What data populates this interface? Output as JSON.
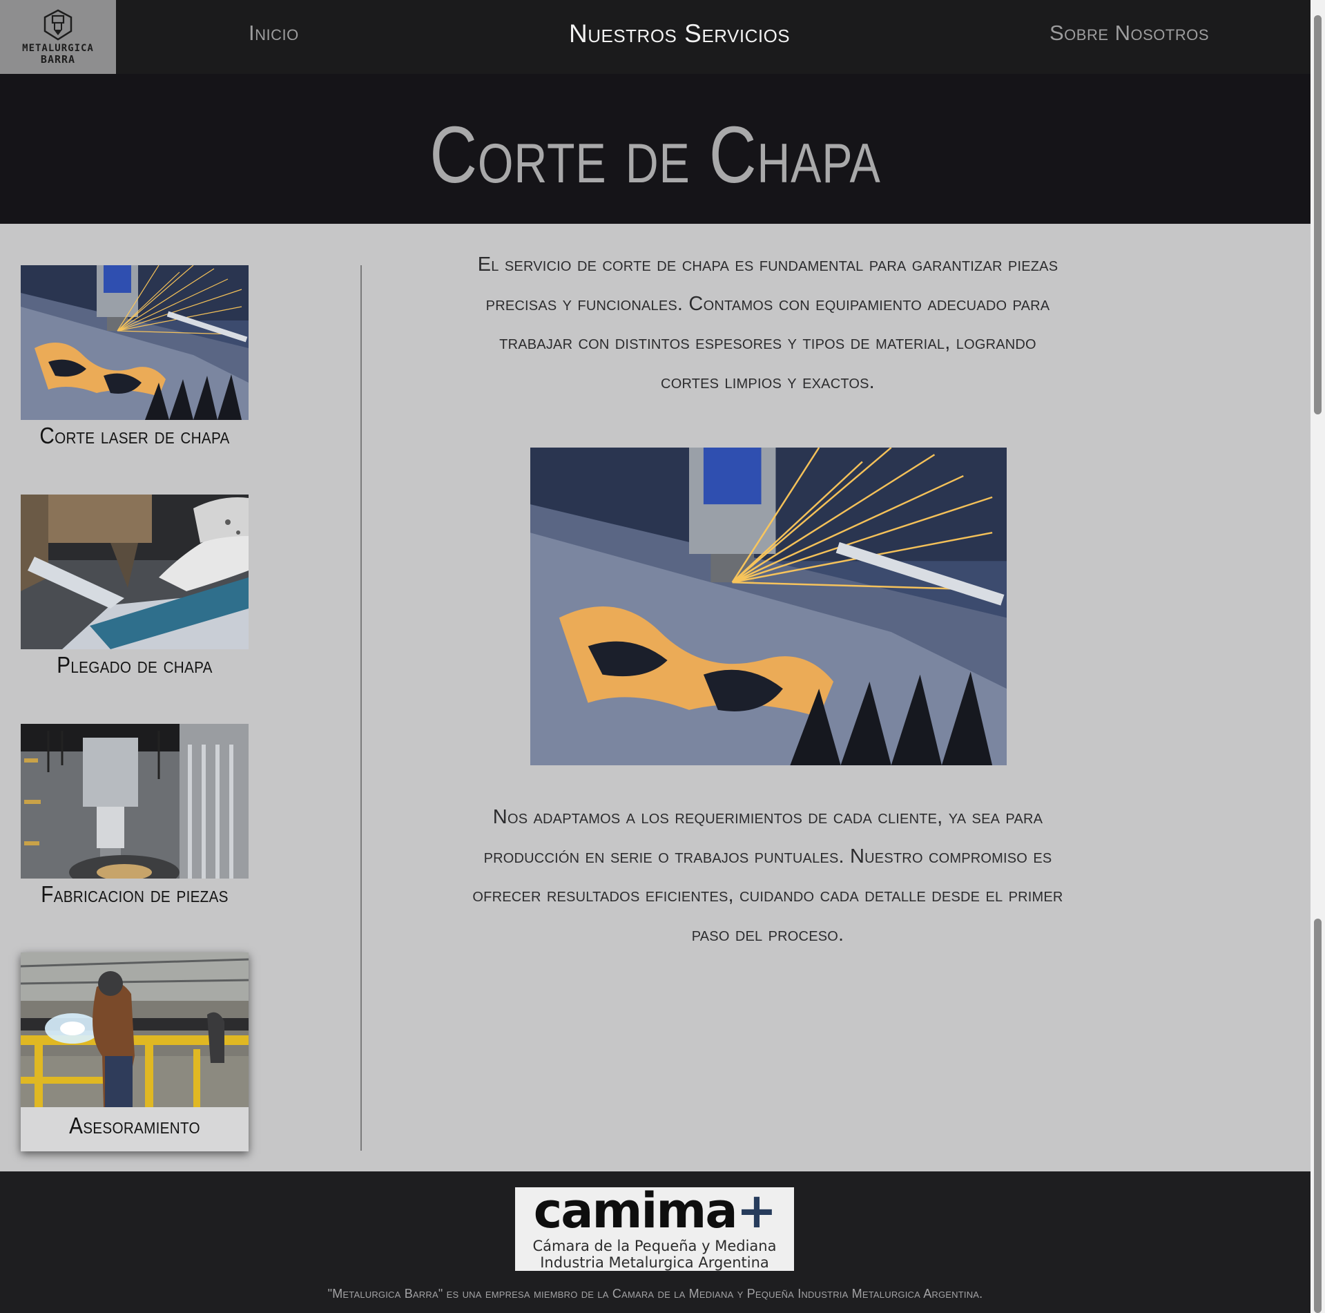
{
  "nav": {
    "logo_line1": "METALURGICA",
    "logo_line2": "BARRA",
    "items": [
      {
        "label": "Inicio"
      },
      {
        "label": "Nuestros Servicios"
      },
      {
        "label": "Sobre Nosotros"
      }
    ],
    "active_index": 1
  },
  "hero": {
    "title": "Corte de Chapa"
  },
  "sidebar": {
    "services": [
      {
        "label": "Corte laser de chapa",
        "icon": "laser-cutting-photo"
      },
      {
        "label": "Plegado de chapa",
        "icon": "sheet-bending-photo"
      },
      {
        "label": "Fabricacion de piezas",
        "icon": "machining-photo"
      },
      {
        "label": "Asesoramiento",
        "icon": "welding-photo"
      }
    ],
    "selected_index": 3
  },
  "main": {
    "paragraph1": "El servicio de corte de chapa es fundamental para garantizar piezas precisas y funcionales. Contamos con equipamiento adecuado para trabajar con distintos espesores y tipos de material, logrando cortes limpios y exactos.",
    "photo_icon": "laser-cutting-photo",
    "paragraph2": "Nos adaptamos a los requerimientos de cada cliente, ya sea para producción en serie o trabajos puntuales. Nuestro compromiso es ofrecer resultados eficientes, cuidando cada detalle desde el primer paso del proceso."
  },
  "footer": {
    "camima_word": "camima",
    "camima_plus": "+",
    "camima_sub1": "Cámara de la Pequeña y Mediana",
    "camima_sub2": "Industria Metalurgica Argentina",
    "note": "\"Metalurgica Barra\" es una empresa miembro de la Camara de la Mediana y Pequeña Industria Metalurgica Argentina."
  },
  "colors": {
    "nav_bg": "#1b1b1c",
    "hero_bg": "#151418",
    "content_bg": "#c6c6c7",
    "footer_bg": "#1e1e20",
    "nav_active": "#f2f2f2",
    "nav_inactive": "#9d9d9e"
  }
}
